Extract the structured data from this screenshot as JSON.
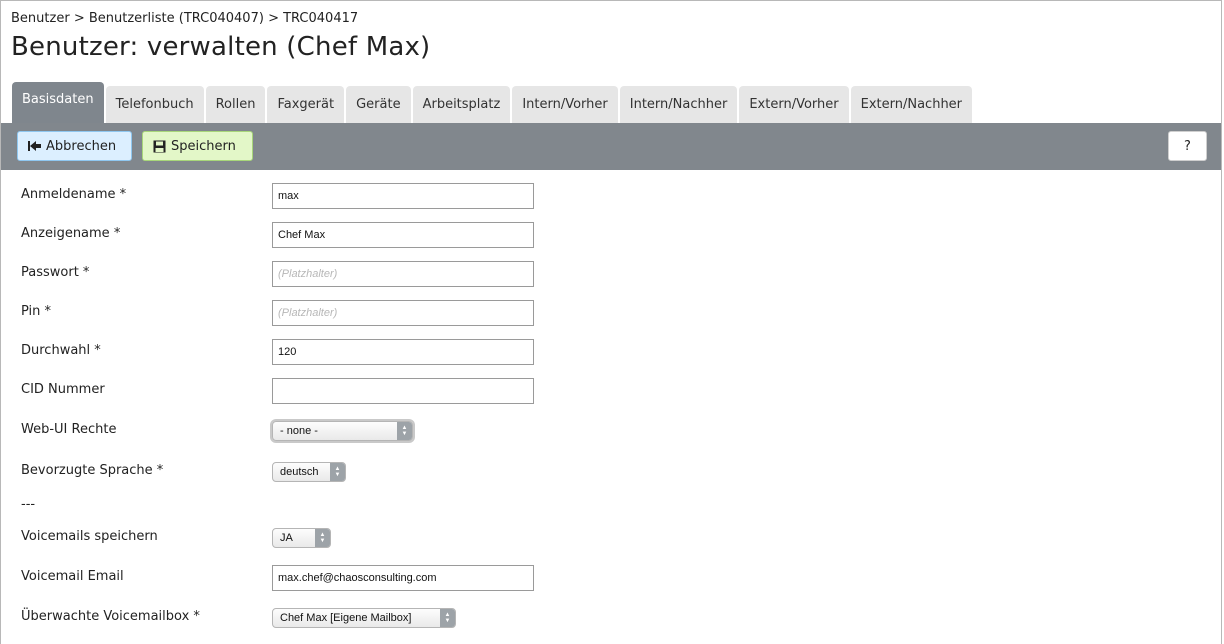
{
  "breadcrumb": {
    "items": [
      "Benutzer",
      "Benutzerliste (TRC040407)",
      "TRC040417"
    ],
    "separator": ">"
  },
  "page_title": "Benutzer: verwalten (Chef Max)",
  "tabs": [
    {
      "label": "Basisdaten",
      "active": true
    },
    {
      "label": "Telefonbuch"
    },
    {
      "label": "Rollen"
    },
    {
      "label": "Faxgerät"
    },
    {
      "label": "Geräte"
    },
    {
      "label": "Arbeitsplatz"
    },
    {
      "label": "Intern/Vorher"
    },
    {
      "label": "Intern/Nachher"
    },
    {
      "label": "Extern/Vorher"
    },
    {
      "label": "Extern/Nachher"
    }
  ],
  "toolbar": {
    "cancel_label": "Abbrechen",
    "cancel_icon": "back-to-start-icon",
    "save_label": "Speichern",
    "save_icon": "floppy-disk-icon",
    "help_label": "?"
  },
  "form": {
    "username": {
      "label": "Anmeldename *",
      "value": "max"
    },
    "display_name": {
      "label": "Anzeigename *",
      "value": "Chef Max"
    },
    "password": {
      "label": "Passwort *",
      "value": "",
      "placeholder": "(Platzhalter)"
    },
    "pin": {
      "label": "Pin *",
      "value": "",
      "placeholder": "(Platzhalter)"
    },
    "extension": {
      "label": "Durchwahl *",
      "value": "120"
    },
    "cid_number": {
      "label": "CID Nummer",
      "value": ""
    },
    "webui_rights": {
      "label": "Web-UI Rechte",
      "value": "- none -"
    },
    "language": {
      "label": "Bevorzugte Sprache *",
      "value": "deutsch"
    },
    "separator": "---",
    "store_voicemails": {
      "label": "Voicemails speichern",
      "value": "JA"
    },
    "voicemail_email": {
      "label": "Voicemail Email",
      "value": "max.chef@chaosconsulting.com"
    },
    "monitored_mailbox": {
      "label": "Überwachte Voicemailbox *",
      "value": "Chef Max [Eigene Mailbox]"
    }
  },
  "colors": {
    "toolbar_bg": "#81878d",
    "active_tab_bg": "#7f868d",
    "cancel_bg": "#dcefff",
    "save_bg": "#e3f7c8"
  }
}
